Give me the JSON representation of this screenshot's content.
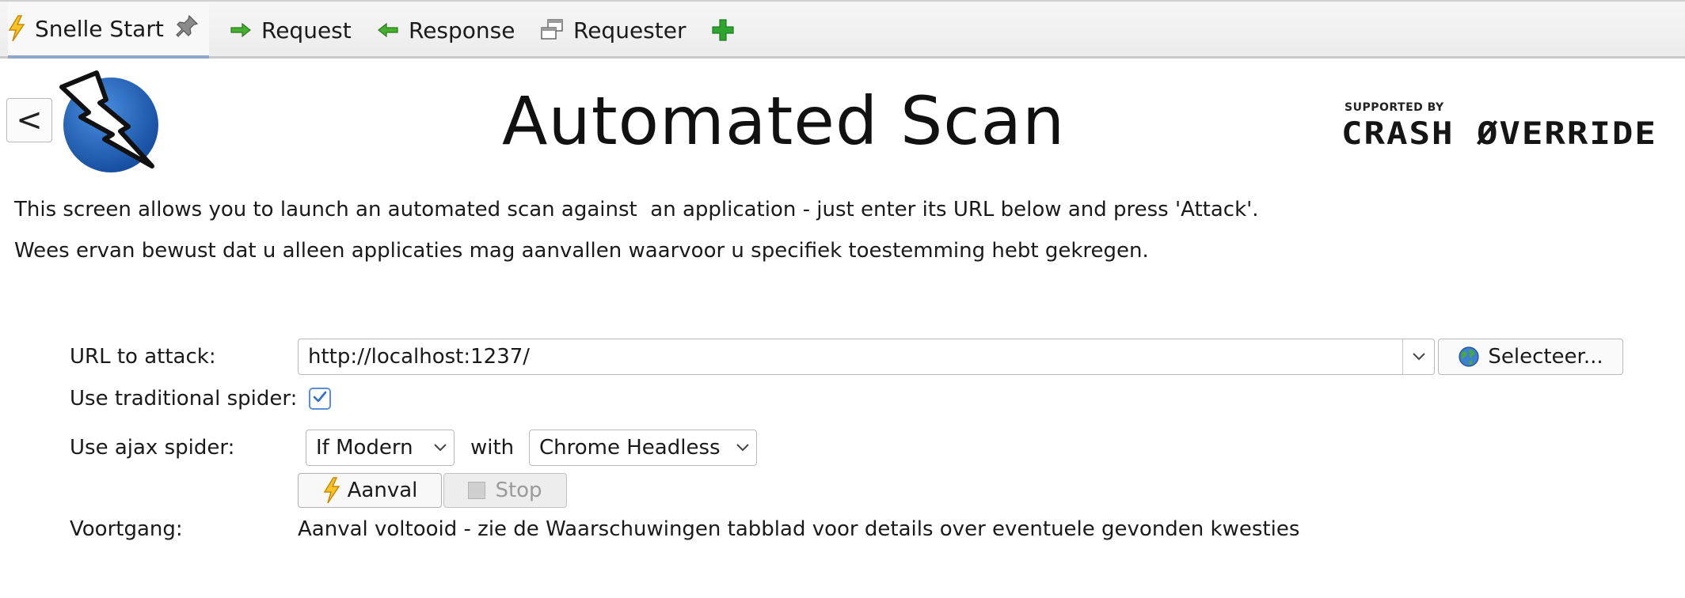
{
  "tabs": [
    {
      "label": "Snelle Start",
      "icon": "lightning-icon",
      "active": true
    },
    {
      "label": "Request",
      "icon": "arrow-right-icon"
    },
    {
      "label": "Response",
      "icon": "arrow-left-icon"
    },
    {
      "label": "Requester",
      "icon": "windows-icon"
    }
  ],
  "add_tab_icon": "plus-icon",
  "pin_icon": "pin-icon",
  "header": {
    "back_label": "<",
    "title": "Automated Scan",
    "supported_by": "SUPPORTED BY",
    "sponsor": "CRASH ØVERRIDE"
  },
  "intro": {
    "line1": "This screen allows you to launch an automated scan against  an application - just enter its URL below and press 'Attack'.",
    "line2": "Wees ervan bewust dat u alleen applicaties mag aanvallen waarvoor u specifiek toestemming hebt gekregen."
  },
  "form": {
    "url_label": "URL to attack:",
    "url_value": "http://localhost:1237/",
    "select_label": "Selecteer...",
    "traditional_spider_label": "Use traditional spider:",
    "traditional_spider_checked": true,
    "ajax_spider_label": "Use ajax spider:",
    "ajax_mode": "If Modern",
    "with_label": "with",
    "browser": "Chrome Headless",
    "attack_label": "Aanval",
    "stop_label": "Stop",
    "progress_label": "Voortgang:",
    "progress_text": "Aanval voltooid - zie de Waarschuwingen tabblad voor details over eventuele gevonden kwesties"
  },
  "colors": {
    "accent": "#2f6fce",
    "add_green": "#2ea52e",
    "arrow_green": "#3aa935",
    "lightning": "#f2b705",
    "logo_blue": "#1f5fb4"
  }
}
